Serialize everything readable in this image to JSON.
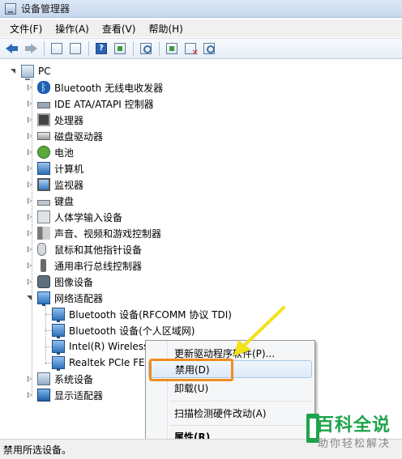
{
  "window": {
    "title": "设备管理器"
  },
  "menu": [
    {
      "label": "文件(F)"
    },
    {
      "label": "操作(A)"
    },
    {
      "label": "查看(V)"
    },
    {
      "label": "帮助(H)"
    }
  ],
  "tree": {
    "root": "PC",
    "items": [
      {
        "label": "Bluetooth 无线电收发器",
        "icon": "bluetooth-icon"
      },
      {
        "label": "IDE ATA/ATAPI 控制器",
        "icon": "ide-controller-icon"
      },
      {
        "label": "处理器",
        "icon": "processor-icon"
      },
      {
        "label": "磁盘驱动器",
        "icon": "disk-drive-icon"
      },
      {
        "label": "电池",
        "icon": "battery-icon"
      },
      {
        "label": "计算机",
        "icon": "computer-icon"
      },
      {
        "label": "监视器",
        "icon": "monitor-icon"
      },
      {
        "label": "键盘",
        "icon": "keyboard-icon"
      },
      {
        "label": "人体学输入设备",
        "icon": "hid-icon"
      },
      {
        "label": "声音、视频和游戏控制器",
        "icon": "audio-icon"
      },
      {
        "label": "鼠标和其他指针设备",
        "icon": "mouse-icon"
      },
      {
        "label": "通用串行总线控制器",
        "icon": "usb-icon"
      },
      {
        "label": "图像设备",
        "icon": "camera-icon"
      },
      {
        "label": "网络适配器",
        "icon": "network-adapter-icon"
      },
      {
        "label": "系统设备",
        "icon": "system-device-icon"
      },
      {
        "label": "显示适配器",
        "icon": "display-adapter-icon"
      }
    ],
    "network_children": [
      {
        "label": "Bluetooth 设备(RFCOMM 协议 TDI)"
      },
      {
        "label": "Bluetooth 设备(个人区域网)"
      },
      {
        "label": "Intel(R) Wireless"
      },
      {
        "label": "Realtek PCIe FE"
      }
    ]
  },
  "context_menu": {
    "items": [
      {
        "label": "更新驱动程序软件(P)..."
      },
      {
        "label": "禁用(D)"
      },
      {
        "label": "卸载(U)"
      },
      {
        "label": "扫描检测硬件改动(A)"
      },
      {
        "label": "属性(R)"
      }
    ]
  },
  "status": {
    "text": "禁用所选设备。"
  },
  "watermark": {
    "title": "百科全说",
    "subtitle": "助你轻松解决"
  },
  "colors": {
    "highlight": "#f08c1f",
    "arrow": "#f2e21a",
    "watermark_green": "#1ea34a"
  }
}
